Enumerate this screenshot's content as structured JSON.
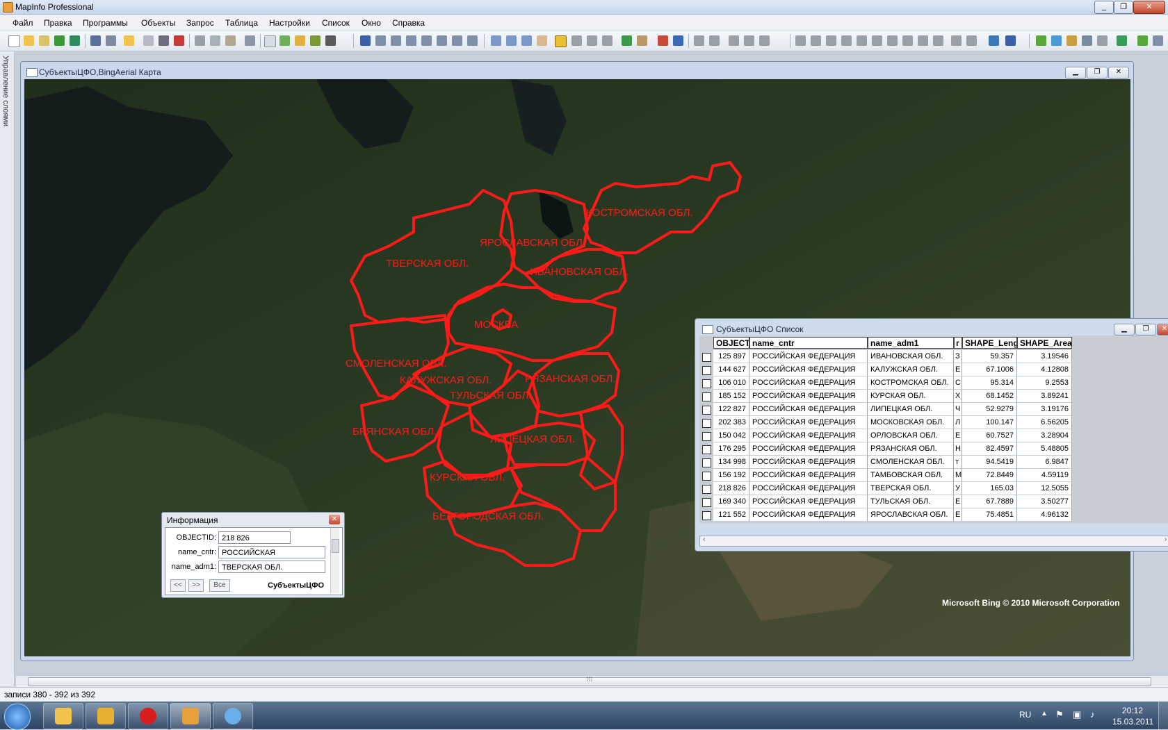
{
  "app": {
    "title": "MapInfo Professional",
    "accent": "#c5d6ec",
    "controls": [
      "_",
      "❐",
      "✕"
    ]
  },
  "menu": [
    "Файл",
    "Правка",
    "Программы",
    "Объекты",
    "Запрос",
    "Таблица",
    "Настройки",
    "Список",
    "Окно",
    "Справка"
  ],
  "layer_panel": {
    "label": "Управление слоями"
  },
  "map_window": {
    "title": "СубъектыЦФО,BingAerial Карта",
    "attribution": "Microsoft Bing © 2010 Microsoft Corporation",
    "boundary_color": "#ff1a1a",
    "regions": [
      "КОСТРОМСКАЯ ОБЛ.",
      "ЯРОСЛАВСКАЯ ОБЛ.",
      "ТВЕРСКАЯ ОБЛ.",
      "ИВАНОВСКАЯ ОБЛ.",
      "МОСКВА",
      "СМОЛЕНСКАЯ ОБЛ.",
      "КАЛУЖСКАЯ ОБЛ.",
      "РЯЗАНСКАЯ ОБЛ.",
      "ТУЛЬСКАЯ ОБЛ.",
      "БРЯНСКАЯ ОБЛ.",
      "ЛИПЕЦКАЯ ОБЛ.",
      "КУРСКАЯ ОБЛ.",
      "БЕЛГОРОДСКАЯ ОБЛ."
    ]
  },
  "list_window": {
    "title": "СубъектыЦФО Список",
    "columns": [
      "OBJECTI",
      "name_cntr",
      "name_adm1",
      "r",
      "SHAPE_Leng",
      "SHAPE_Area"
    ],
    "rows": [
      {
        "id": "125 897",
        "cntr": "РОССИЙСКАЯ ФЕДЕРАЦИЯ",
        "adm1": "ИВАНОВСКАЯ ОБЛ.",
        "r": "З",
        "len": "59.357",
        "area": "3.19546"
      },
      {
        "id": "144 627",
        "cntr": "РОССИЙСКАЯ ФЕДЕРАЦИЯ",
        "adm1": "КАЛУЖСКАЯ ОБЛ.",
        "r": "Е",
        "len": "67.1006",
        "area": "4.12808"
      },
      {
        "id": "106 010",
        "cntr": "РОССИЙСКАЯ ФЕДЕРАЦИЯ",
        "adm1": "КОСТРОМСКАЯ ОБЛ.",
        "r": "С",
        "len": "95.314",
        "area": "9.2553"
      },
      {
        "id": "185 152",
        "cntr": "РОССИЙСКАЯ ФЕДЕРАЦИЯ",
        "adm1": "КУРСКАЯ ОБЛ.",
        "r": "Х",
        "len": "68.1452",
        "area": "3.89241"
      },
      {
        "id": "122 827",
        "cntr": "РОССИЙСКАЯ ФЕДЕРАЦИЯ",
        "adm1": "ЛИПЕЦКАЯ ОБЛ.",
        "r": "Ч",
        "len": "52.9279",
        "area": "3.19176"
      },
      {
        "id": "202 383",
        "cntr": "РОССИЙСКАЯ ФЕДЕРАЦИЯ",
        "adm1": "МОСКОВСКАЯ ОБЛ.",
        "r": "Л",
        "len": "100.147",
        "area": "6.56205"
      },
      {
        "id": "150 042",
        "cntr": "РОССИЙСКАЯ ФЕДЕРАЦИЯ",
        "adm1": "ОРЛОВСКАЯ ОБЛ.",
        "r": "Е",
        "len": "60.7527",
        "area": "3.28904"
      },
      {
        "id": "176 295",
        "cntr": "РОССИЙСКАЯ ФЕДЕРАЦИЯ",
        "adm1": "РЯЗАНСКАЯ ОБЛ.",
        "r": "Н",
        "len": "82.4597",
        "area": "5.48805"
      },
      {
        "id": "134 998",
        "cntr": "РОССИЙСКАЯ ФЕДЕРАЦИЯ",
        "adm1": "СМОЛЕНСКАЯ ОБЛ.",
        "r": "т",
        "len": "94.5419",
        "area": "6.9847"
      },
      {
        "id": "156 192",
        "cntr": "РОССИЙСКАЯ ФЕДЕРАЦИЯ",
        "adm1": "ТАМБОВСКАЯ ОБЛ.",
        "r": "М",
        "len": "72.8449",
        "area": "4.59119"
      },
      {
        "id": "218 826",
        "cntr": "РОССИЙСКАЯ ФЕДЕРАЦИЯ",
        "adm1": "ТВЕРСКАЯ ОБЛ.",
        "r": "У",
        "len": "165.03",
        "area": "12.5055"
      },
      {
        "id": "169 340",
        "cntr": "РОССИЙСКАЯ ФЕДЕРАЦИЯ",
        "adm1": "ТУЛЬСКАЯ ОБЛ.",
        "r": "Е",
        "len": "67.7889",
        "area": "3.50277"
      },
      {
        "id": "121 552",
        "cntr": "РОССИЙСКАЯ ФЕДЕРАЦИЯ",
        "adm1": "ЯРОСЛАВСКАЯ ОБЛ.",
        "r": "Е",
        "len": "75.4851",
        "area": "4.96132"
      }
    ]
  },
  "info_window": {
    "title": "Информация",
    "fields": [
      {
        "label": "OBJECTID:",
        "value": "218 826"
      },
      {
        "label": "name_cntr:",
        "value": "РОССИЙСКАЯ ФЕДЕРАЦИЯ"
      },
      {
        "label": "name_adm1:",
        "value": "ТВЕРСКАЯ ОБЛ."
      }
    ],
    "prev": "<<",
    "next": ">>",
    "all": "Все",
    "table": "СубъектыЦФО",
    "close": "✕"
  },
  "status": {
    "text": "записи 380 - 392 из 392"
  },
  "taskbar": {
    "lang": "RU",
    "time": "20:12",
    "date": "15.03.2011",
    "apps": [
      "start-icon",
      "explorer-icon",
      "winamp-icon",
      "opera-icon",
      "mapinfo-icon",
      "paint-icon"
    ]
  }
}
